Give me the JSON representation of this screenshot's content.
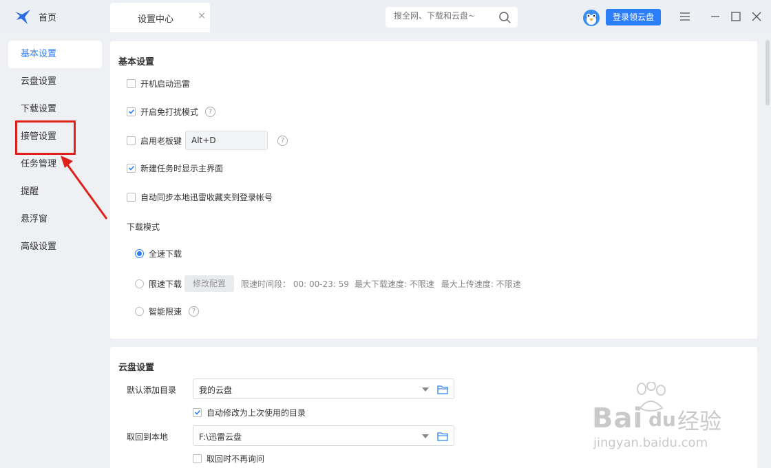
{
  "titlebar": {
    "home_label": "首页",
    "tab_label": "设置中心",
    "tab_close": "×",
    "search_placeholder": "搜全网、下载和云盘~",
    "login_button": "登录领云盘"
  },
  "sidebar": {
    "items": [
      {
        "label": "基本设置",
        "active": true
      },
      {
        "label": "云盘设置"
      },
      {
        "label": "下载设置"
      },
      {
        "label": "接管设置"
      },
      {
        "label": "任务管理"
      },
      {
        "label": "提醒"
      },
      {
        "label": "悬浮窗"
      },
      {
        "label": "高级设置"
      }
    ]
  },
  "basic": {
    "title": "基本设置",
    "startup": {
      "label": "开机启动迅雷",
      "checked": false
    },
    "no_disturb": {
      "label": "开启免打扰模式",
      "checked": true
    },
    "boss_key": {
      "label": "启用老板键",
      "checked": false,
      "value": "Alt+D"
    },
    "show_main": {
      "label": "新建任务时显示主界面",
      "checked": true
    },
    "sync_fav": {
      "label": "自动同步本地迅雷收藏夹到登录帐号",
      "checked": false
    },
    "download_mode_title": "下载模式",
    "full_speed": {
      "label": "全速下载",
      "selected": true
    },
    "limit_speed": {
      "label": "限速下载",
      "modify_btn": "修改配置",
      "period": "限速时间段： 00: 00-23: 59",
      "max_down": "最大下载速度: 不限速",
      "max_up": "最大上传速度: 不限速"
    },
    "smart_limit": {
      "label": "智能限速"
    },
    "help_glyph": "?"
  },
  "cloud": {
    "title": "云盘设置",
    "default_dir_label": "默认添加目录",
    "default_dir_value": "我的云盘",
    "auto_modify": {
      "label": "自动修改为上次使用的目录",
      "checked": true
    },
    "fetch_label": "取回到本地",
    "fetch_value": "F:\\迅雷云盘",
    "no_ask": {
      "label": "取回时不再询问",
      "checked": false
    }
  },
  "watermark": {
    "brand": "Bai",
    "brand2": "du",
    "cn": "经验",
    "url": "jingyan.baidu.com"
  },
  "colors": {
    "accent": "#2d7ff9",
    "annotation": "#e0201b"
  }
}
